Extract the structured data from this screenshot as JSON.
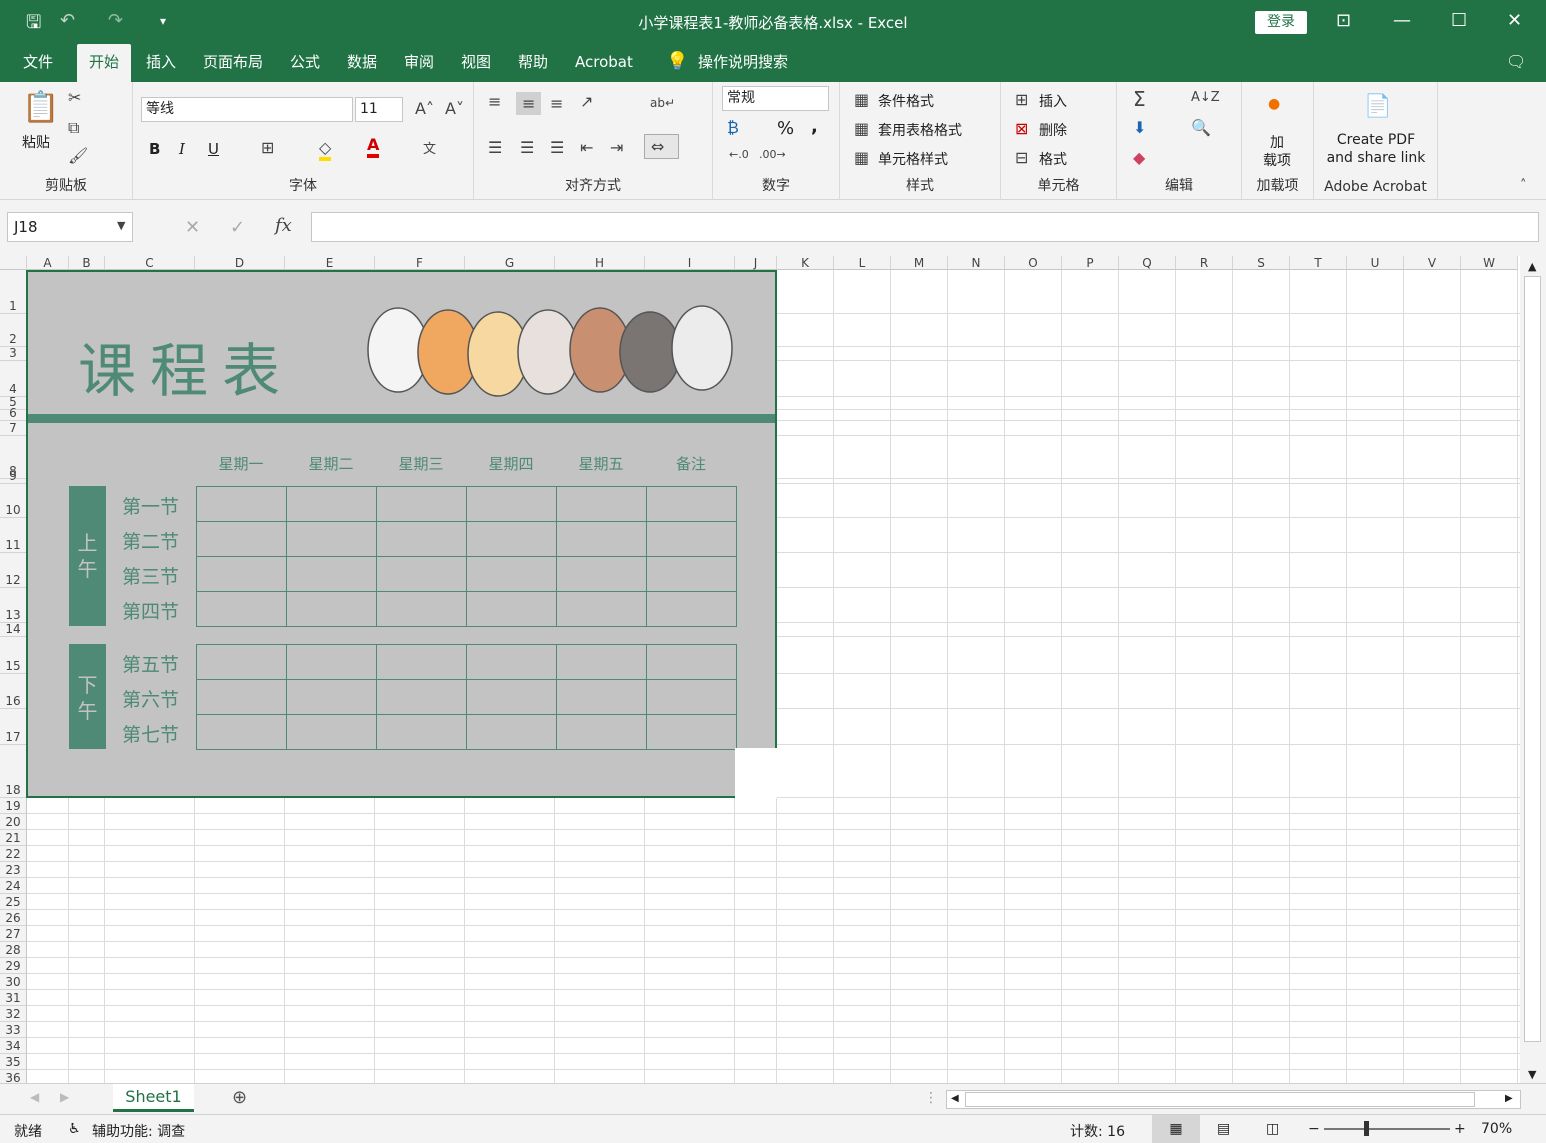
{
  "title_bar": {
    "title": "小学课程表1-教师必备表格.xlsx - Excel",
    "login": "登录"
  },
  "menu": [
    "文件",
    "开始",
    "插入",
    "页面布局",
    "公式",
    "数据",
    "审阅",
    "视图",
    "帮助",
    "Acrobat"
  ],
  "tell_me": "操作说明搜索",
  "ribbon": {
    "clipboard": {
      "paste": "粘贴",
      "label": "剪贴板"
    },
    "font": {
      "name": "等线",
      "size": "11",
      "bold": "B",
      "italic": "I",
      "underline": "U",
      "label": "字体"
    },
    "alignment": {
      "label": "对齐方式"
    },
    "number": {
      "format": "常规",
      "percent": "%",
      "comma": ",",
      "label": "数字"
    },
    "styles": {
      "conditional": "条件格式",
      "table": "套用表格格式",
      "cell": "单元格样式",
      "label": "样式"
    },
    "cells": {
      "insert": "插入",
      "delete": "删除",
      "format": "格式",
      "label": "单元格"
    },
    "editing": {
      "label": "编辑"
    },
    "addins": {
      "line1": "加",
      "line2": "载项",
      "label": "加载项"
    },
    "acrobat": {
      "line1": "Create PDF",
      "line2": "and share link",
      "label": "Adobe Acrobat"
    }
  },
  "formula_bar": {
    "name_box": "J18",
    "fx": "fx",
    "content": ""
  },
  "columns": [
    "A",
    "B",
    "C",
    "D",
    "E",
    "F",
    "G",
    "H",
    "I",
    "J",
    "K",
    "L",
    "M",
    "N",
    "O",
    "P",
    "Q",
    "R",
    "S",
    "T",
    "U",
    "V",
    "W"
  ],
  "schedule": {
    "title": "课程表",
    "days": [
      "星期一",
      "星期二",
      "星期三",
      "星期四",
      "星期五",
      "备注"
    ],
    "morning_label": "上午",
    "afternoon_label": "下午",
    "morning_periods": [
      "第一节",
      "第二节",
      "第三节",
      "第四节"
    ],
    "afternoon_periods": [
      "第五节",
      "第六节",
      "第七节"
    ]
  },
  "sheet_tab": "Sheet1",
  "status": {
    "ready": "就绪",
    "accessibility": "辅助功能: 调查",
    "count": "计数: 16",
    "zoom": "70%"
  }
}
